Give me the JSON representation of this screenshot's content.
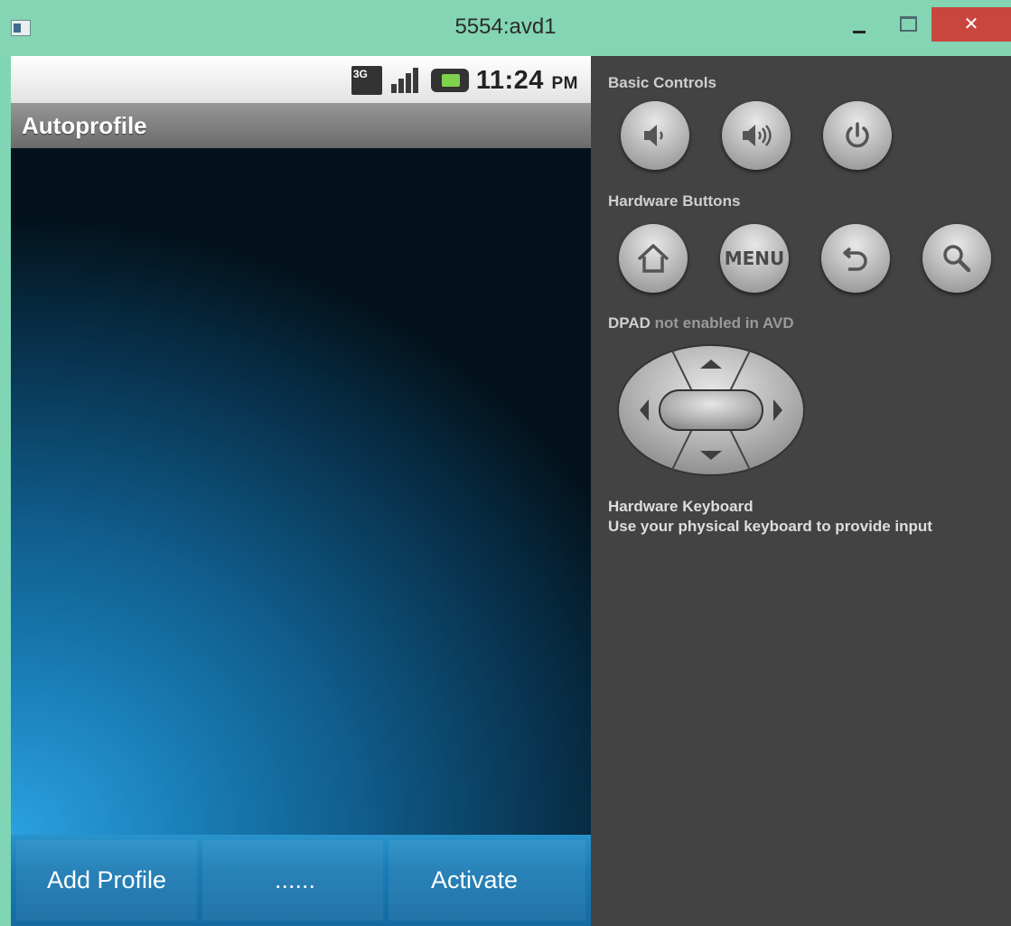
{
  "window": {
    "title": "5554:avd1",
    "close_glyph": "✕"
  },
  "phone": {
    "status_bar": {
      "network_badge": "3G",
      "time": "11:24",
      "ampm": "PM",
      "icons": [
        "3g-data-icon",
        "signal-strength-icon",
        "battery-charging-icon"
      ]
    },
    "app_title": "Autoprofile",
    "bottom_bar": {
      "add_profile": "Add Profile",
      "more": "......",
      "activate": "Activate"
    }
  },
  "panel": {
    "basic_controls_label": "Basic Controls",
    "hardware_buttons_label": "Hardware Buttons",
    "menu_label": "MENU",
    "dpad_label_strong": "DPAD",
    "dpad_label_rest": "not enabled in AVD",
    "keyboard_title": "Hardware Keyboard",
    "keyboard_desc": "Use your physical keyboard to provide input"
  },
  "colors": {
    "title_bar": "#83d5b3",
    "close_button": "#c9463f",
    "panel_background": "#434343",
    "screen_accent": "#2ba0e0"
  }
}
